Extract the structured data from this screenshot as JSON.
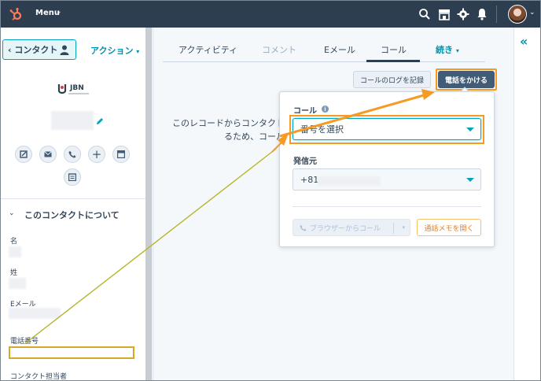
{
  "topnav": {
    "menu_label": "Menu",
    "colors": {
      "background": "#2d3e50",
      "logo": "#ff7a59"
    },
    "icons": [
      "hubspot-logo-icon",
      "search-icon",
      "marketplace-icon",
      "settings-gear-icon",
      "notifications-bell-icon"
    ]
  },
  "sidebar": {
    "back_button": "‹ コンタクト",
    "actions_label": "アクション",
    "company_logo_text": "JBN",
    "quick_actions": [
      "note-icon",
      "email-icon",
      "call-icon",
      "add-icon",
      "log-icon",
      "task-icon"
    ],
    "about_title": "このコンタクトについて",
    "fields": {
      "first_name": "名",
      "last_name": "姓",
      "email": "Eメール",
      "phone": "電話番号",
      "owner": "コンタクト担当者"
    }
  },
  "tabs": {
    "activity": "アクティビティ",
    "comment": "コメント",
    "email": "Eメール",
    "call": "コール",
    "more": "続き"
  },
  "toolbar": {
    "log_call": "コールのログを記録",
    "make_call": "電話をかける"
  },
  "main": {
    "empty_line1": "このレコードからコンタクトに",
    "empty_line2": "るため、コール"
  },
  "call_popover": {
    "call_label": "コール",
    "number_placeholder": "番号を選択",
    "from_label": "発信元",
    "from_value": "+81",
    "browser_call": "ブラウザーからコール",
    "open_memo": "通話メモを開く"
  },
  "annotation": {
    "highlight_color": "#f59a23",
    "arrow_color": "#f59a23",
    "line_color": "#b5b52a"
  }
}
